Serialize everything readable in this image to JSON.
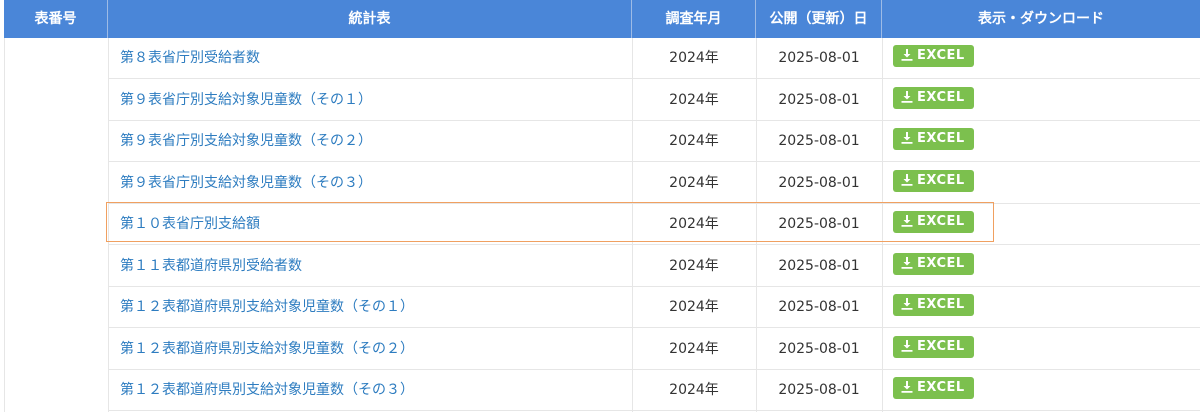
{
  "header": {
    "num": "表番号",
    "name": "統計表",
    "year": "調査年月",
    "published": "公開（更新）日",
    "download": "表示・ダウンロード"
  },
  "rows": [
    {
      "name": "第８表省庁別受給者数",
      "year": "2024年",
      "published": "2025-08-01",
      "button": "EXCEL"
    },
    {
      "name": "第９表省庁別支給対象児童数（その１）",
      "year": "2024年",
      "published": "2025-08-01",
      "button": "EXCEL"
    },
    {
      "name": "第９表省庁別支給対象児童数（その２）",
      "year": "2024年",
      "published": "2025-08-01",
      "button": "EXCEL"
    },
    {
      "name": "第９表省庁別支給対象児童数（その３）",
      "year": "2024年",
      "published": "2025-08-01",
      "button": "EXCEL"
    },
    {
      "name": "第１０表省庁別支給額",
      "year": "2024年",
      "published": "2025-08-01",
      "button": "EXCEL"
    },
    {
      "name": "第１１表都道府県別受給者数",
      "year": "2024年",
      "published": "2025-08-01",
      "button": "EXCEL"
    },
    {
      "name": "第１２表都道府県別支給対象児童数（その１）",
      "year": "2024年",
      "published": "2025-08-01",
      "button": "EXCEL"
    },
    {
      "name": "第１２表都道府県別支給対象児童数（その２）",
      "year": "2024年",
      "published": "2025-08-01",
      "button": "EXCEL"
    },
    {
      "name": "第１２表都道府県別支給対象児童数（その３）",
      "year": "2024年",
      "published": "2025-08-01",
      "button": "EXCEL"
    }
  ],
  "colors": {
    "header_bg": "#4a86d8",
    "link": "#2d7cc0",
    "excel_button": "#7cc04e",
    "highlight": "#f0a060"
  },
  "icons": {
    "download": "download-icon"
  }
}
